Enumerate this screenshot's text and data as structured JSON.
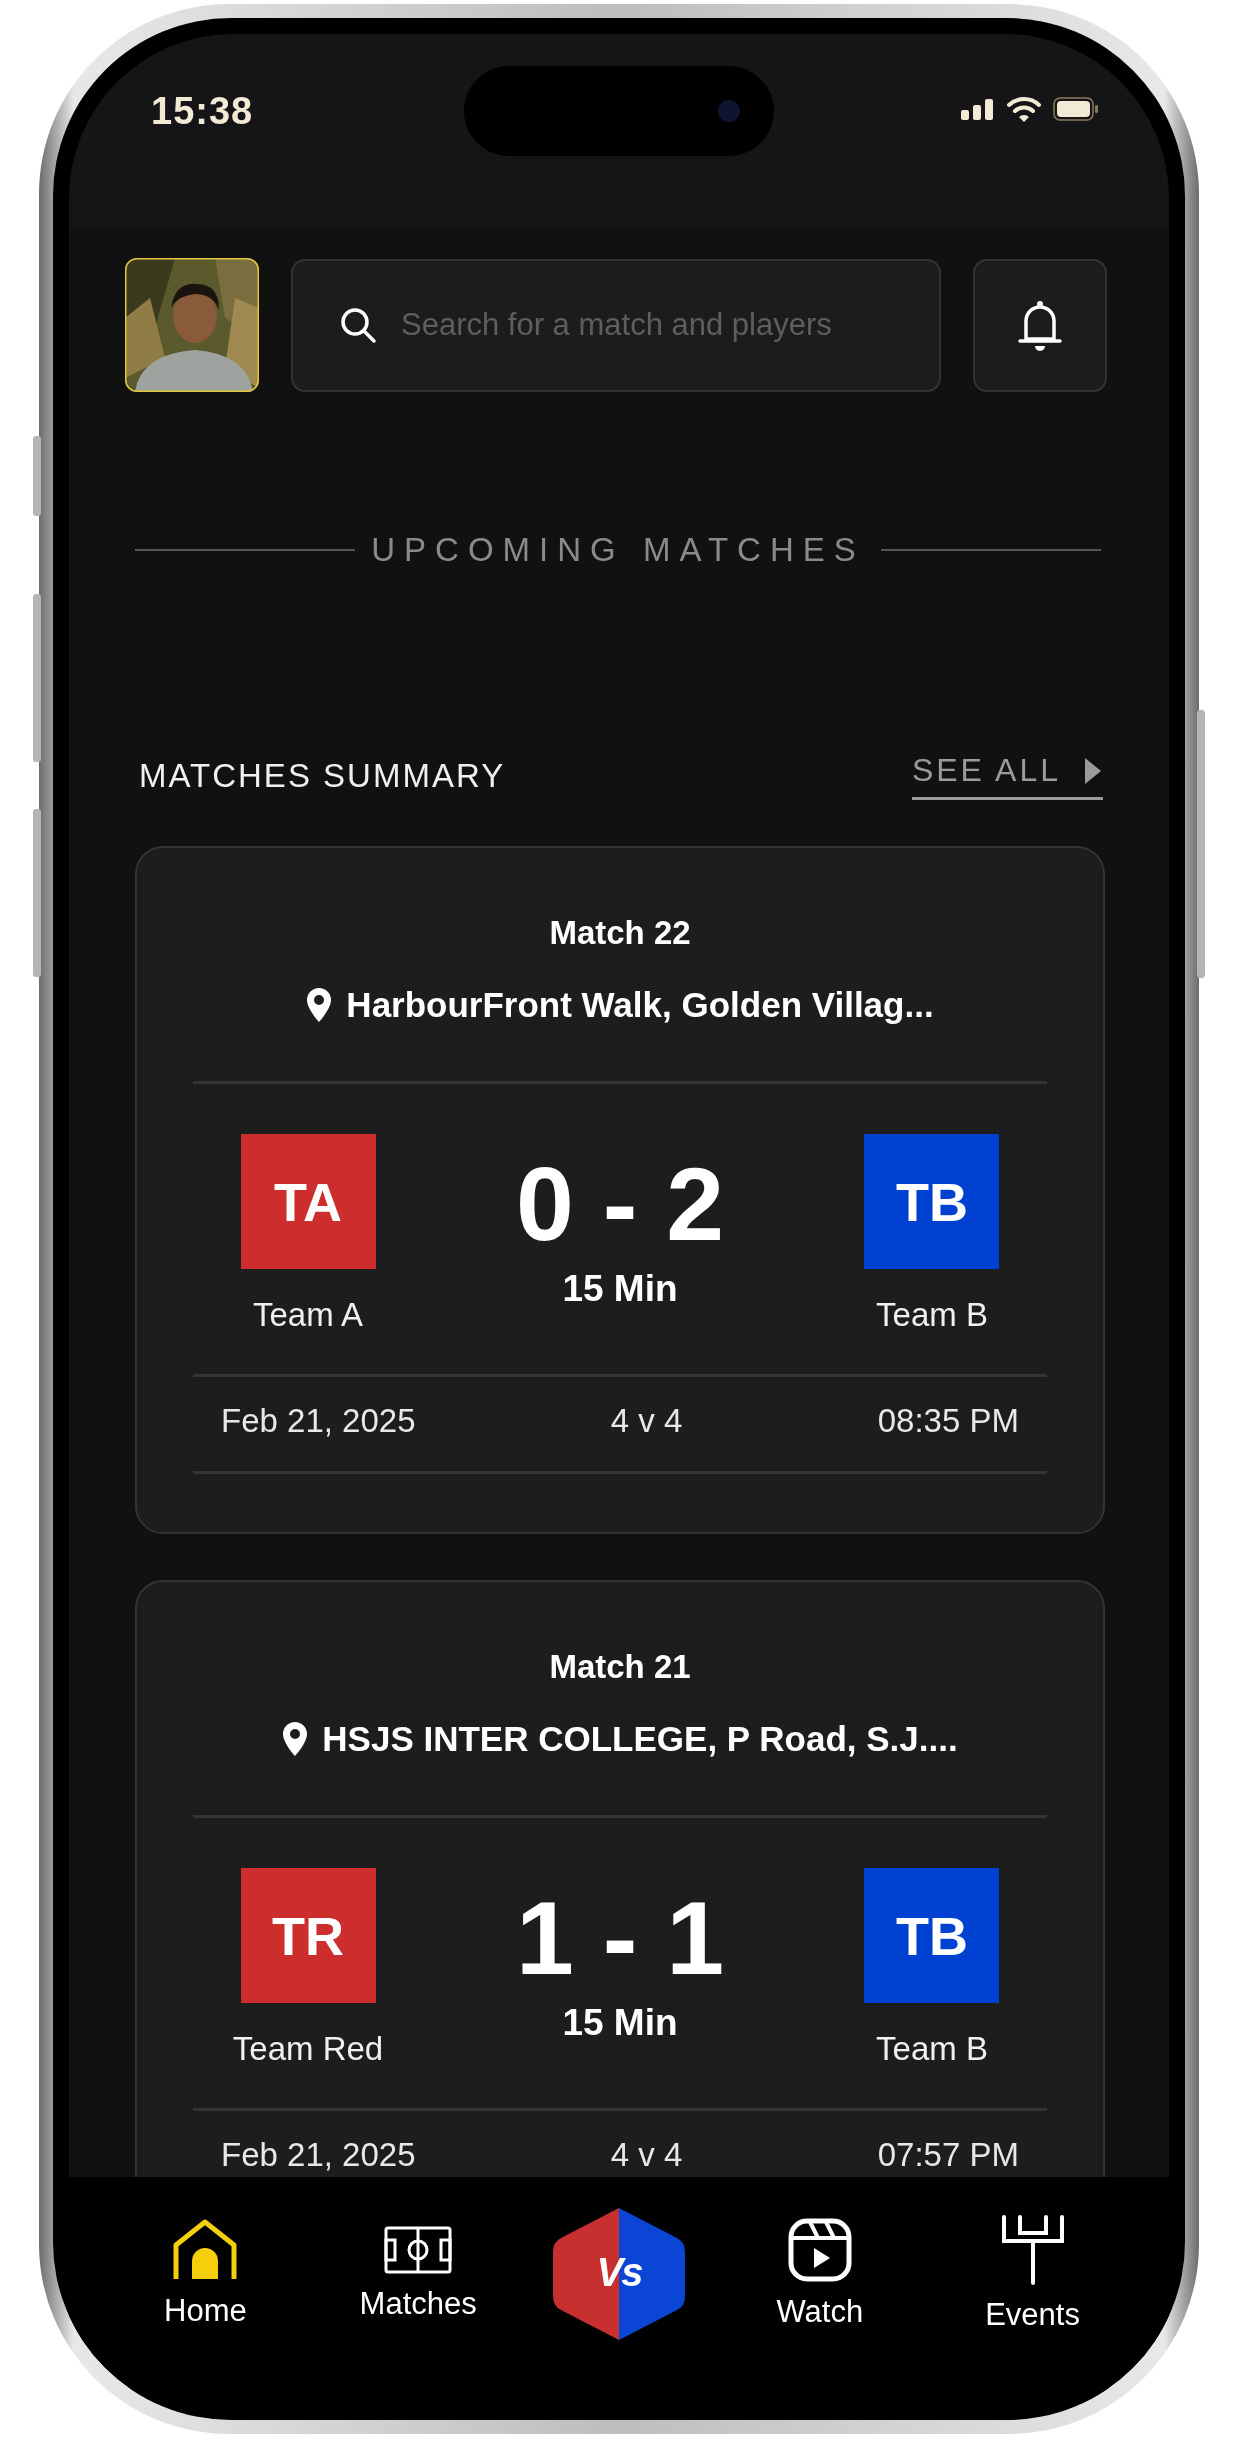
{
  "status_bar": {
    "time": "15:38"
  },
  "search": {
    "placeholder": "Search for a match and players"
  },
  "section_title": "UPCOMING MATCHES",
  "summary": {
    "title": "MATCHES SUMMARY",
    "see_all": "SEE ALL"
  },
  "matches": [
    {
      "title": "Match 22",
      "location": "HarbourFront Walk, Golden Villag...",
      "home": {
        "code": "TA",
        "name": "Team A",
        "color": "#cc2e2e"
      },
      "away": {
        "code": "TB",
        "name": "Team B",
        "color": "#0041d1"
      },
      "score": "0 - 2",
      "duration": "15 Min",
      "date": "Feb 21, 2025",
      "format": "4 v 4",
      "time": "08:35 PM"
    },
    {
      "title": "Match 21",
      "location": "HSJS INTER COLLEGE, P Road, S.J....",
      "home": {
        "code": "TR",
        "name": "Team Red",
        "color": "#cc2e2e"
      },
      "away": {
        "code": "TB",
        "name": "Team B",
        "color": "#0041d1"
      },
      "score": "1 - 1",
      "duration": "15 Min",
      "date": "Feb 21, 2025",
      "format": "4 v 4",
      "time": "07:57 PM"
    }
  ],
  "nav": [
    {
      "kind": "home",
      "label": "Home",
      "selected": true
    },
    {
      "kind": "matches",
      "label": "Matches",
      "selected": false
    },
    {
      "kind": "vs",
      "label": "Vs",
      "selected": false
    },
    {
      "kind": "watch",
      "label": "Watch",
      "selected": false
    },
    {
      "kind": "events",
      "label": "Events",
      "selected": false
    }
  ]
}
